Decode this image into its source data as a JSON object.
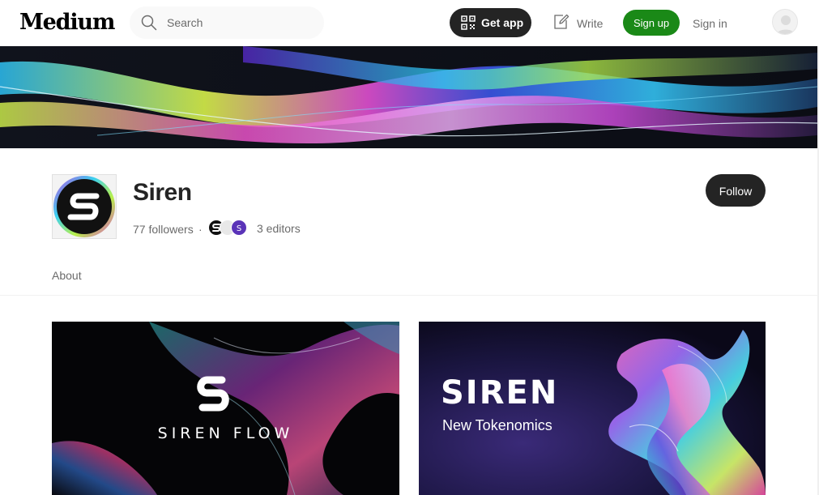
{
  "nav": {
    "logo": "Medium",
    "search_placeholder": "Search",
    "get_app_label": "Get app",
    "write_label": "Write",
    "sign_up_label": "Sign up",
    "sign_in_label": "Sign in",
    "icons": {
      "search": "search-icon",
      "get_app": "qr-code-icon",
      "write": "edit-icon",
      "avatar": "user-icon"
    }
  },
  "publication": {
    "name": "Siren",
    "followers": "77 followers",
    "separator": "·",
    "editors": "3 editors",
    "follow_label": "Follow",
    "tabs": [
      "About"
    ]
  },
  "posts": [
    {
      "image_text": "SIREN FLOW"
    },
    {
      "image_title": "SIREN",
      "image_subtitle": "New Tokenomics"
    }
  ],
  "colors": {
    "brand_green": "#1a8917",
    "dark_button": "#242424",
    "muted_text": "#6b6b6b"
  }
}
